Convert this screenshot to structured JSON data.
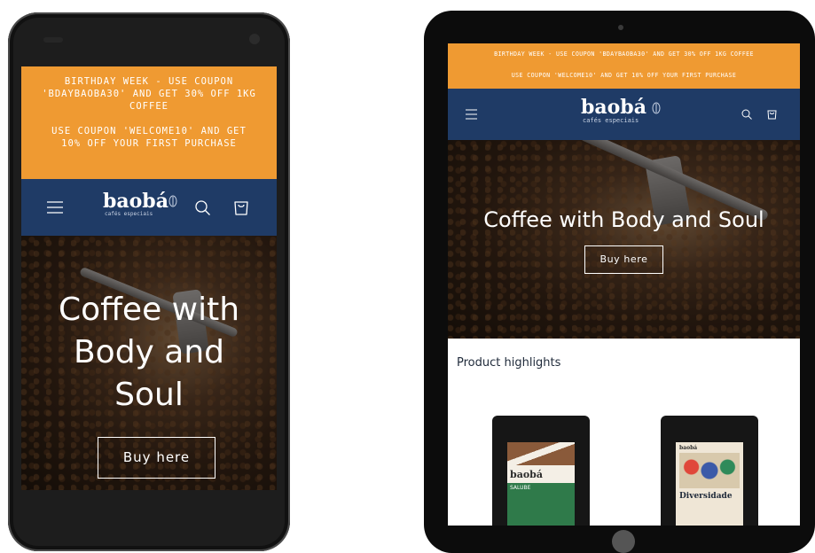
{
  "store": {
    "brand": "baobá",
    "tagline": "cafés especiais"
  },
  "phone": {
    "banner_1": "BIRTHDAY WEEK - USE COUPON 'BDAYBAOBA30' AND GET 30% OFF 1KG COFFEE",
    "banner_2": "USE COUPON 'WELCOME10' AND GET 10% OFF YOUR FIRST PURCHASE",
    "hero_title": "Coffee with Body and Soul",
    "hero_button": "Buy here"
  },
  "tablet": {
    "banner_1": "BIRTHDAY WEEK - USE COUPON 'BDAYBAOBA30' AND GET 30% OFF 1KG COFFEE",
    "banner_2": "USE COUPON 'WELCOME10' AND GET 10% OFF YOUR FIRST PURCHASE",
    "hero_title": "Coffee with Body and Soul",
    "hero_button": "Buy here",
    "section_title": "Product highlights",
    "products": [
      {
        "brand": "baobá",
        "name": "SALUBE",
        "label_color": "#2f7a4a"
      },
      {
        "brand": "baobá",
        "name": "Diversidade",
        "label_color": "#e8d9c0"
      }
    ]
  },
  "colors": {
    "banner": "#ef9a32",
    "nav": "#1f3b66"
  },
  "icons": [
    "menu-icon",
    "search-icon",
    "cart-icon",
    "leaf-icon"
  ]
}
